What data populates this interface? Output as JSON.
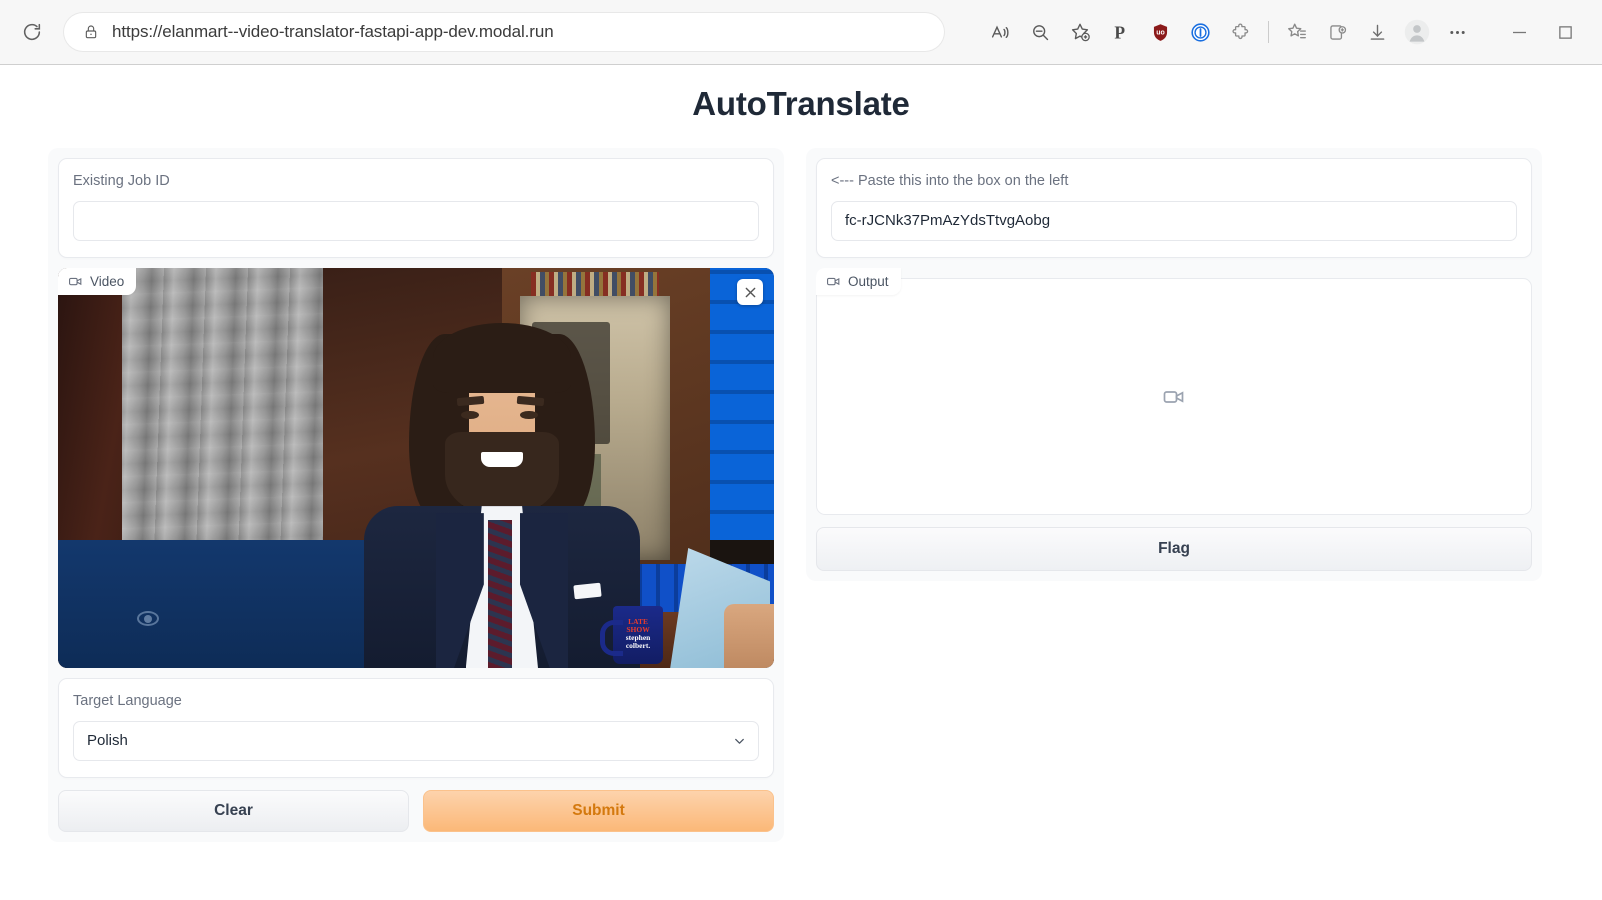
{
  "browser": {
    "url": "https://elanmart--video-translator-fastapi-app-dev.modal.run",
    "icons": {
      "reload": "reload-icon",
      "lock": "lock-icon",
      "read_aloud": "read-aloud-icon",
      "zoom_out": "zoom-out-icon",
      "add_favorite": "add-favorite-icon",
      "paypal_ext": "paypal-extension-icon",
      "ublock_ext": "ublock-origin-extension-icon",
      "onepassword_ext": "onepassword-extension-icon",
      "extensions": "extensions-puzzle-icon",
      "favorites": "favorites-list-icon",
      "collections": "collections-icon",
      "downloads": "downloads-icon",
      "profile": "profile-avatar-icon",
      "settings": "settings-ellipsis-icon",
      "minimize": "minimize-icon",
      "maximize": "maximize-icon"
    }
  },
  "app": {
    "title": "AutoTranslate",
    "accent_submit_bg": "#fbb878",
    "accent_submit_text": "#d4790e",
    "title_color": "#1f2937",
    "panel_bg": "#f9fafb"
  },
  "left": {
    "job_id": {
      "label": "Existing Job ID",
      "value": "",
      "placeholder": ""
    },
    "video": {
      "badge_label": "Video",
      "badge_icon": "video-camera-icon",
      "close_icon": "close-icon",
      "scene": {
        "mug_line1": "LATE",
        "mug_line2": "SHOW",
        "mug_line3": "stephen",
        "mug_line4": "colbert.",
        "watermark": "cbs-eye-logo"
      }
    },
    "target_language": {
      "label": "Target Language",
      "value": "Polish",
      "chevron_icon": "chevron-down-icon",
      "options": [
        "Polish"
      ]
    },
    "buttons": {
      "clear": "Clear",
      "submit": "Submit"
    }
  },
  "right": {
    "paste_hint": {
      "label": "<--- Paste this into the box on the left",
      "value": "fc-rJCNk37PmAzYdsTtvgAobg"
    },
    "output": {
      "badge_label": "Output",
      "badge_icon": "video-camera-icon",
      "placeholder_icon": "video-camera-placeholder-icon"
    },
    "flag_button": "Flag"
  }
}
